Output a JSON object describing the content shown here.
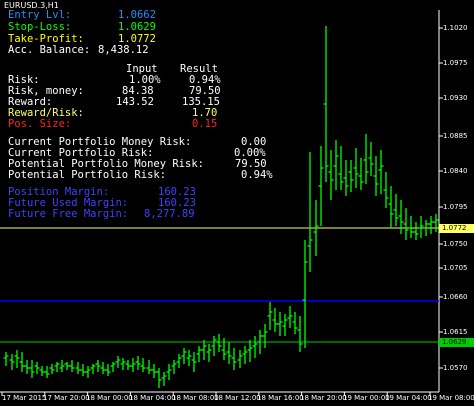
{
  "title": "EURUSD.3,H1",
  "panel": {
    "entry_label": "Entry Lvl:",
    "entry_value": "1.0662",
    "stoploss_label": "Stop-Loss:",
    "stoploss_value": "1.0629",
    "takeprofit_label": "Take-Profit:",
    "takeprofit_value": "1.0772",
    "balance_label": "Acc. Balance:",
    "balance_value": "8,438.12",
    "input_header": "Input",
    "result_header": "Result",
    "risk_label": "Risk:",
    "risk_input": "1.00%",
    "risk_result": "0.94%",
    "risk_money_label": "Risk, money:",
    "risk_money_input": "84.38",
    "risk_money_result": "79.50",
    "reward_label": "Reward:",
    "reward_input": "143.52",
    "reward_result": "135.15",
    "rr_label": "Reward/Risk:",
    "rr_value": "1.70",
    "pos_size_label": "Pos. Size:",
    "pos_size_value": "0.15",
    "cur_money_risk_label": "Current Portfolio Money Risk:",
    "cur_money_risk_value": "0.00",
    "cur_risk_label": "Current Portfolio Risk:",
    "cur_risk_value": "0.00%",
    "pot_money_risk_label": "Potential Portfolio Money Risk:",
    "pot_money_risk_value": "79.50",
    "pot_risk_label": "Potential Portfolio Risk:",
    "pot_risk_value": "0.94%",
    "pos_margin_label": "Position Margin:",
    "pos_margin_value": "160.23",
    "fut_used_margin_label": "Future Used Margin:",
    "fut_used_margin_value": "160.23",
    "fut_free_margin_label": "Future Free Margin:",
    "fut_free_margin_value": "8,277.89"
  },
  "price_axis": [
    "1.1020",
    "1.0975",
    "1.0930",
    "1.0885",
    "1.0840",
    "1.0795",
    "1.0750",
    "1.0705",
    "1.0660",
    "1.0615",
    "1.0570"
  ],
  "price_axis_extra": "1.0660",
  "price_tags": {
    "takeprofit": "1.0772",
    "stoploss": "1.0629"
  },
  "time_axis": [
    "17 Mar 2015",
    "17 Mar 20:00",
    "18 Mar 00:00",
    "18 Mar 04:00",
    "18 Mar 08:00",
    "18 Mar 12:00",
    "18 Mar 16:00",
    "18 Mar 20:00",
    "19 Mar 00:00",
    "19 Mar 04:00",
    "19 Mar 08:00"
  ],
  "colors": {
    "background": "#000000",
    "candles": "#00ff00",
    "takeprofit_line": "#ffff66",
    "entry_line": "#0000ff",
    "stoploss_line": "#00cc00",
    "label_blue": "#4040ff",
    "label_red": "#ff2020",
    "text": "#ffffff",
    "entry_text": "#1e90ff",
    "stoploss_text": "#00ff00",
    "takeprofit_text": "#ffff00"
  }
}
